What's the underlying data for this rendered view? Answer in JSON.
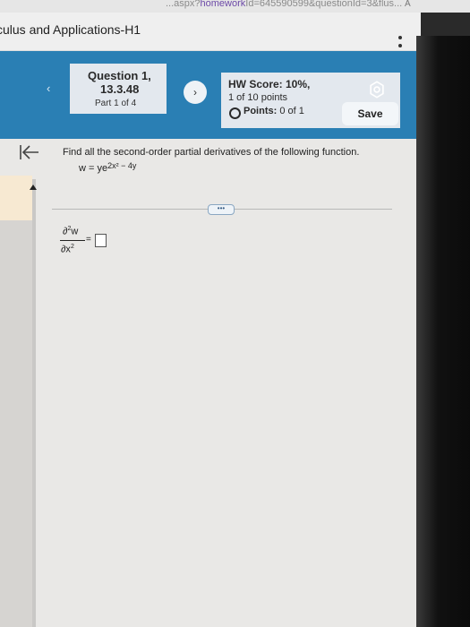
{
  "browser": {
    "url_prefix": "...aspx?",
    "url_mid": "homework",
    "url_rest": "Id=645590599&questionId=3&flus...",
    "reader_label": "A"
  },
  "course": {
    "title": "culus and Applications-H1"
  },
  "question": {
    "title": "Question 1,",
    "number": "13.3.48",
    "part": "Part 1 of 4"
  },
  "hw": {
    "score": "HW Score: 10%,",
    "points_total": "1 of 10 points",
    "points_label": "Points:",
    "points_value": "0 of 1"
  },
  "buttons": {
    "save": "Save",
    "prev": "‹",
    "next": "›",
    "more": "•••"
  },
  "content": {
    "prompt": "Find all the second-order partial derivatives of the following function.",
    "func_lhs": "w = ye",
    "func_exp": "2x² − 4y",
    "deriv_num": "∂",
    "deriv_num_sup": "2",
    "deriv_num_var": "w",
    "deriv_den": "∂x",
    "deriv_den_sup": "2",
    "equals": "="
  },
  "colors": {
    "header_blue": "#2a7fb4",
    "panel_tab": "#f7e9d2"
  }
}
